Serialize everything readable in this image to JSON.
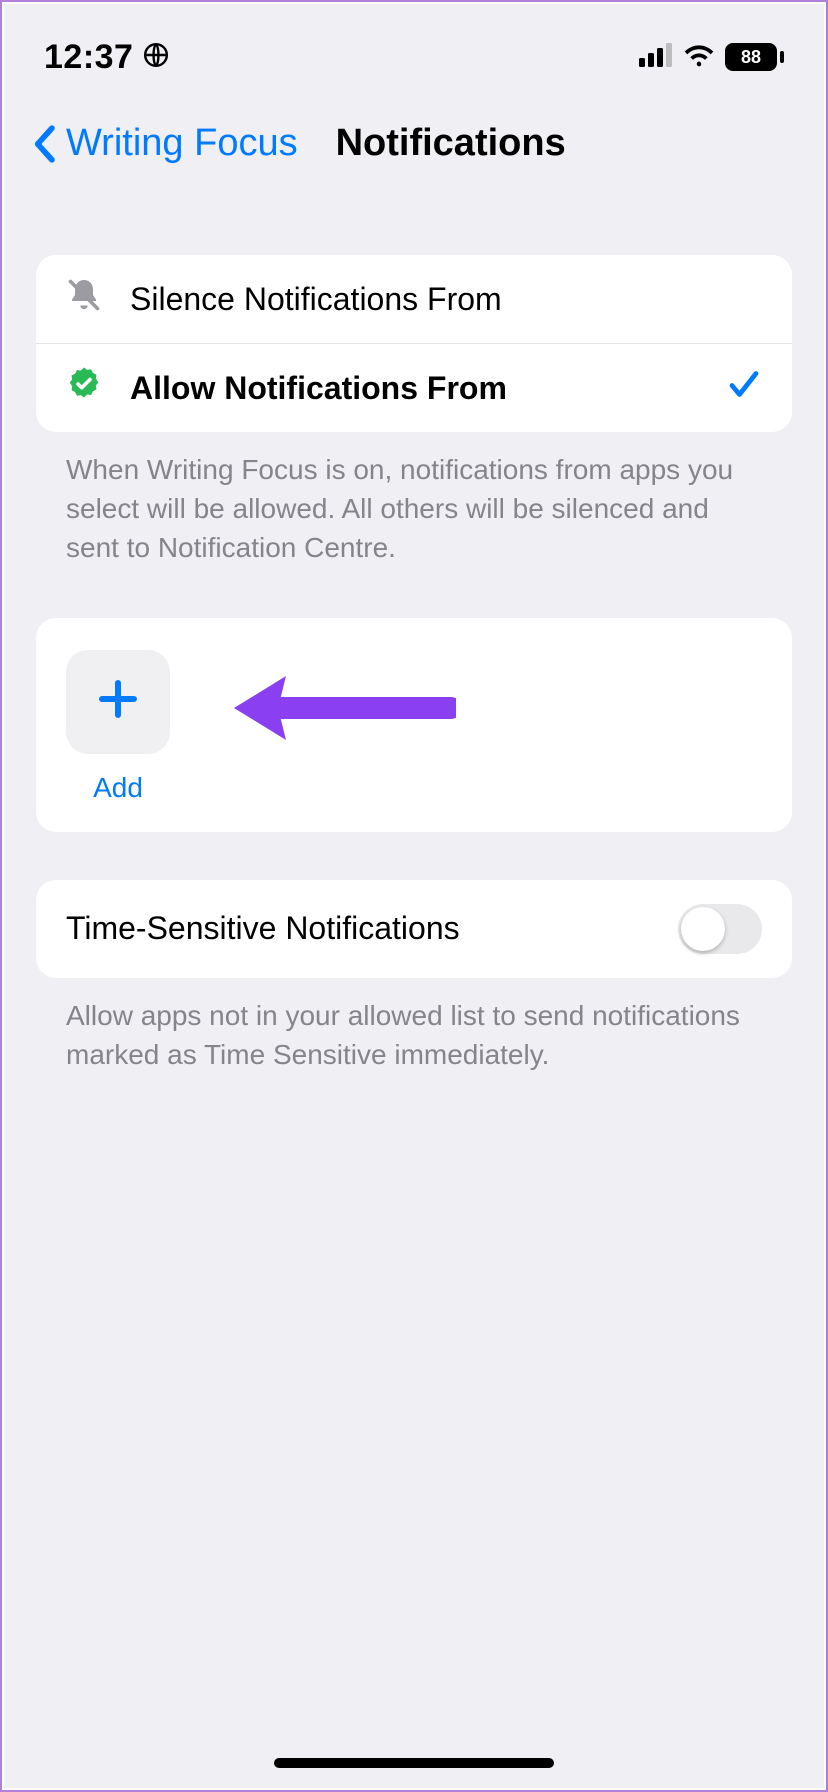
{
  "status": {
    "time": "12:37",
    "battery_percent": "88"
  },
  "nav": {
    "back_label": "Writing Focus",
    "title": "Notifications"
  },
  "mode": {
    "silence_label": "Silence Notifications From",
    "allow_label": "Allow Notifications From",
    "footer": "When Writing Focus is on, notifications from apps you select will be allowed. All others will be silenced and sent to Notification Centre."
  },
  "add": {
    "label": "Add"
  },
  "time_sensitive": {
    "label": "Time-Sensitive Notifications",
    "footer": "Allow apps not in your allowed list to send notifications marked as Time Sensitive immediately.",
    "enabled": false
  },
  "colors": {
    "accent": "#007aff",
    "annotation": "#8a3ff0"
  }
}
